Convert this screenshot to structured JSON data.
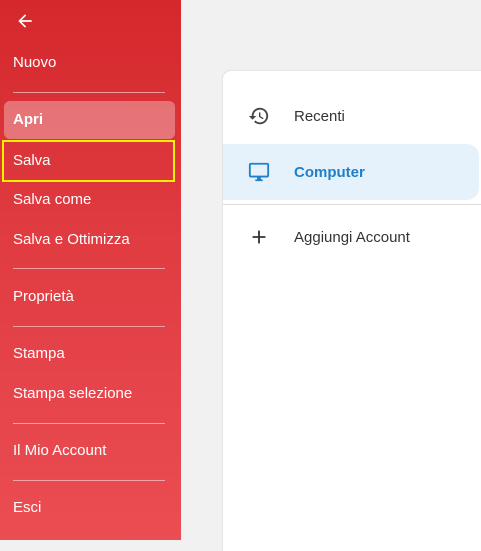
{
  "sidebar": {
    "items": [
      {
        "label": "Nuovo"
      },
      {
        "label": "Apri"
      },
      {
        "label": "Salva"
      },
      {
        "label": "Salva come"
      },
      {
        "label": "Salva e Ottimizza"
      },
      {
        "label": "Proprietà"
      },
      {
        "label": "Stampa"
      },
      {
        "label": "Stampa selezione"
      },
      {
        "label": "Il Mio Account"
      },
      {
        "label": "Esci"
      }
    ]
  },
  "panel": {
    "items": [
      {
        "label": "Recenti",
        "icon": "history-icon"
      },
      {
        "label": "Computer",
        "icon": "computer-icon"
      },
      {
        "label": "Aggiungi Account",
        "icon": "plus-icon"
      }
    ]
  },
  "colors": {
    "sidebar_top": "#d4282c",
    "sidebar_bottom": "#ea4d53",
    "selected_bg": "#e5f2fc",
    "selected_text": "#1f7fc8",
    "highlight_border": "#f2f200"
  }
}
